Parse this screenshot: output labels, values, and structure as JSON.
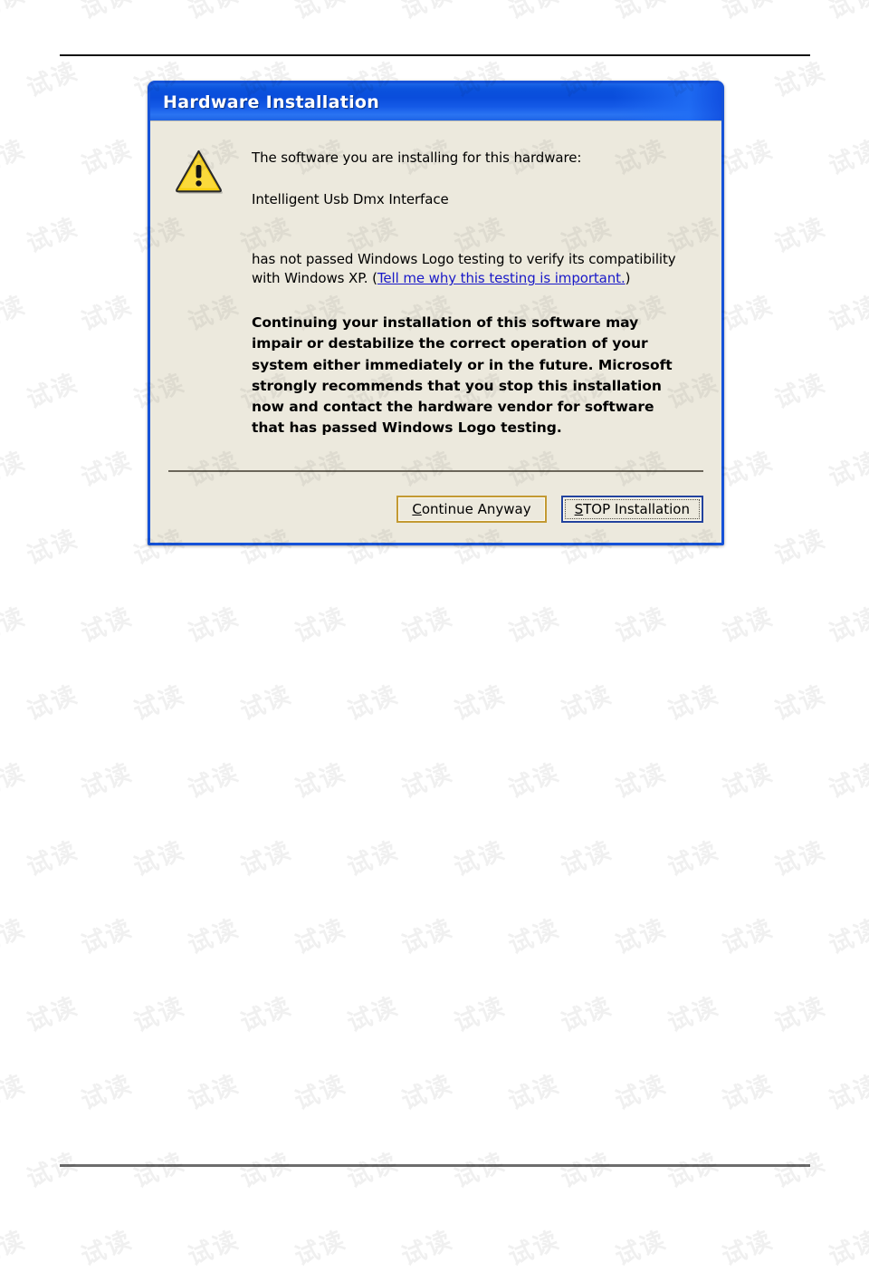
{
  "page": {
    "background_color": "#ffffff",
    "watermark_text": "试读",
    "rule_color_top": "#111111",
    "rule_color_bottom": "#6d6d6d"
  },
  "dialog": {
    "title": "Hardware Installation",
    "titlebar_color": "#0a4ddc",
    "body_color": "#ece9dd",
    "border_color": "#1552d8",
    "icon": "warning-triangle-icon",
    "icon_fill": "#ffd40a",
    "message_intro": "The software you are installing for this hardware:",
    "hardware_name": "Intelligent Usb Dmx Interface",
    "compat_text_before_link": "has not passed Windows Logo testing to verify its compatibility with Windows XP. (",
    "link_text": "Tell me why this testing is important.",
    "link_color": "#1919c8",
    "compat_text_after_link": ")",
    "warning_text": "Continuing your installation of this software may impair or destabilize the correct operation of your system either immediately or in the future. Microsoft strongly recommends that you stop this installation now and contact the hardware vendor for software that has passed Windows Logo testing.",
    "buttons": {
      "continue": {
        "accelerator": "C",
        "rest": "ontinue Anyway",
        "border_color": "#c39a33",
        "focused": false
      },
      "stop": {
        "accelerator": "S",
        "rest": "TOP Installation",
        "border_color": "#22429e",
        "focused": true
      }
    }
  }
}
